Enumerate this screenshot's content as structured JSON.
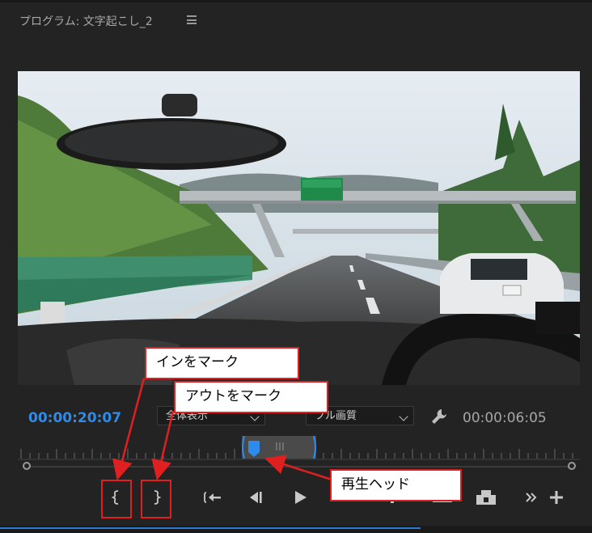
{
  "panel": {
    "title": "プログラム: 文字起こし_2",
    "menu_icon": "hamburger-menu-icon"
  },
  "timecodes": {
    "current": "00:00:20:07",
    "duration": "00:00:06:05"
  },
  "dropdowns": {
    "zoom": "全体表示",
    "quality": "フル画質"
  },
  "controls": [
    {
      "name": "mark-in-button",
      "icon": "mark-in-icon",
      "glyph": "{"
    },
    {
      "name": "mark-out-button",
      "icon": "mark-out-icon",
      "glyph": "}"
    },
    {
      "name": "go-to-in-button",
      "icon": "go-to-in-icon",
      "glyph": "{←"
    },
    {
      "name": "step-back-button",
      "icon": "step-back-icon",
      "glyph": "◀|"
    },
    {
      "name": "play-button",
      "icon": "play-icon",
      "glyph": "▶"
    },
    {
      "name": "insert-button",
      "icon": "insert-icon",
      "glyph": ""
    },
    {
      "name": "export-frame-button",
      "icon": "camera-icon",
      "glyph": ""
    },
    {
      "name": "more-controls-button",
      "icon": "double-chevron-right-icon",
      "glyph": "»"
    },
    {
      "name": "button-editor-button",
      "icon": "plus-icon",
      "glyph": "+"
    }
  ],
  "annotations": {
    "mark_in": "インをマーク",
    "mark_out": "アウトをマーク",
    "playhead": "再生ヘッド"
  },
  "colors": {
    "timecode_active": "#2d8ceb",
    "annotation_red": "#e02020",
    "playhead_blue": "#2d8ceb"
  }
}
